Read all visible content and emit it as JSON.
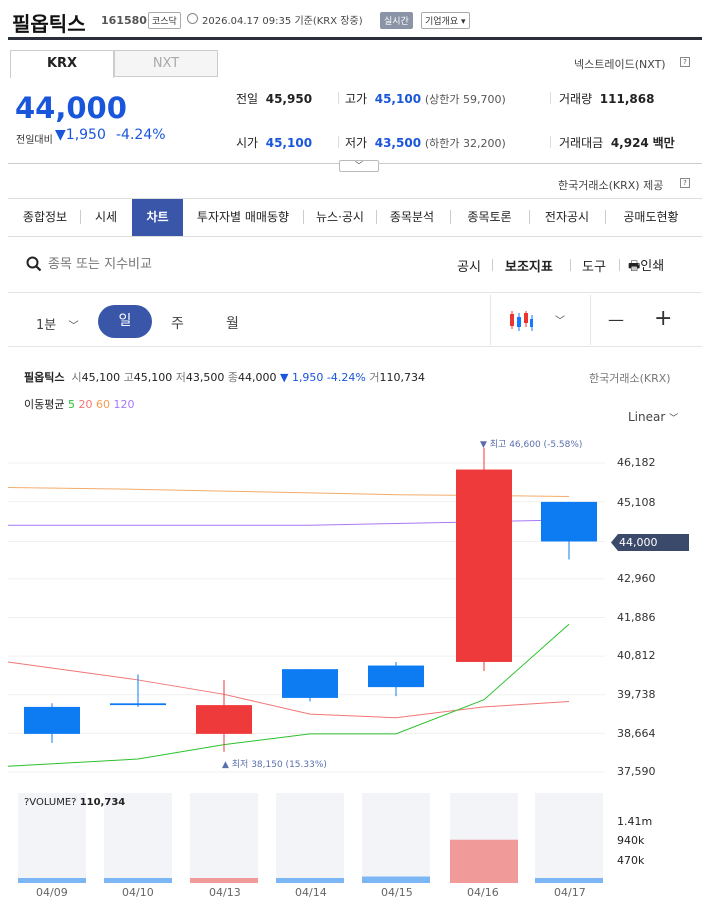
{
  "header": {
    "name": "필옵틱스",
    "code": "161580",
    "market": "코스닥",
    "datetime": "2026.04.17 09:35",
    "basis": "기준(KRX 장중)",
    "live": "실시간",
    "overview": "기업개요",
    "overview_caret": "▾"
  },
  "exchange_tabs": [
    "KRX",
    "NXT"
  ],
  "nxt_link": "넥스트레이드(NXT)",
  "krx_provider": "한국거래소(KRX) 제공",
  "price": {
    "current": "44,000",
    "change_label": "전일대비",
    "change_arrow": "▼",
    "change": "1,950",
    "change_pct": "-4.24%"
  },
  "stats": {
    "prev_label": "전일",
    "prev": "45,950",
    "high_label": "고가",
    "high": "45,100",
    "upper_limit": "(상한가 59,700)",
    "volume_label": "거래량",
    "volume": "111,868",
    "open_label": "시가",
    "open": "45,100",
    "low_label": "저가",
    "low": "43,500",
    "lower_limit": "(하한가 32,200)",
    "amount_label": "거래대금",
    "amount": "4,924",
    "amount_unit": "백만"
  },
  "main_tabs": [
    "종합정보",
    "시세",
    "차트",
    "투자자별 매매동향",
    "뉴스·공시",
    "종목분석",
    "종목토론",
    "전자공시",
    "공매도현황"
  ],
  "toolbar": {
    "search_placeholder": "종목 또는 지수비교",
    "disclosure": "공시",
    "indicators": "보조지표",
    "tools": "도구",
    "print": "인쇄"
  },
  "period": {
    "minute": "1분",
    "day": "일",
    "week": "주",
    "month": "월",
    "minus": "—",
    "plus": "+"
  },
  "chart_info": {
    "name": "필옵틱스",
    "o_label": "시",
    "o": "45,100",
    "h_label": "고",
    "h": "45,100",
    "l_label": "저",
    "l": "43,500",
    "c_label": "종",
    "c": "44,000",
    "chg": "▼ 1,950 -4.24%",
    "v_label": "거",
    "v": "110,734",
    "source": "한국거래소(KRX)",
    "ma_label": "이동평균",
    "ma5": "5",
    "ma20": "20",
    "ma60": "60",
    "ma120": "120",
    "scale": "Linear",
    "max_note": "▼ 최고 46,600 (-5.58%)",
    "min_note": "▲ 최저 38,150 (15.33%)",
    "last_price": "44,000",
    "volume_label": "?VOLUME?",
    "volume_value": "110,734"
  },
  "colors": {
    "up": "#ee3a3a",
    "down": "#0d7cf2",
    "ma5": "#2cc12c",
    "ma20": "#f47575",
    "ma60": "#f3ac6c",
    "ma120": "#a879f5",
    "accent": "#3a56a8"
  },
  "chart_data": {
    "type": "candlestick",
    "dates": [
      "04/09",
      "04/10",
      "04/13",
      "04/14",
      "04/15",
      "04/16",
      "04/17"
    ],
    "ohlc": [
      {
        "open": 39400,
        "high": 39500,
        "low": 38400,
        "close": 38650
      },
      {
        "open": 39500,
        "high": 40300,
        "low": 39400,
        "close": 39450
      },
      {
        "open": 38650,
        "high": 40150,
        "low": 38150,
        "close": 39450
      },
      {
        "open": 40450,
        "high": 40450,
        "low": 39550,
        "close": 39650
      },
      {
        "open": 40550,
        "high": 40650,
        "low": 39700,
        "close": 39950
      },
      {
        "open": 40650,
        "high": 46600,
        "low": 40400,
        "close": 46000
      },
      {
        "open": 45100,
        "high": 45100,
        "low": 43500,
        "close": 44000
      }
    ],
    "ma5": [
      37750,
      37950,
      38350,
      38650,
      38650,
      39600,
      41700
    ],
    "ma20": [
      40650,
      40150,
      39750,
      39200,
      39100,
      39400,
      39550
    ],
    "ma60": [
      45500,
      45450,
      45400,
      45350,
      45300,
      45280,
      45250
    ],
    "ma120": [
      44450,
      44450,
      44450,
      44450,
      44500,
      44550,
      44600
    ],
    "volume": [
      110000,
      90000,
      65000,
      70000,
      150000,
      1000000,
      110734
    ],
    "y_ticks": [
      "46,182",
      "45,108",
      "44,000",
      "42,960",
      "41,886",
      "40,812",
      "39,738",
      "38,664",
      "37,590"
    ],
    "y_range": [
      37590,
      46182
    ],
    "vol_ticks": [
      "1.41m",
      "940k",
      "470k"
    ],
    "vol_max": 1410000
  }
}
